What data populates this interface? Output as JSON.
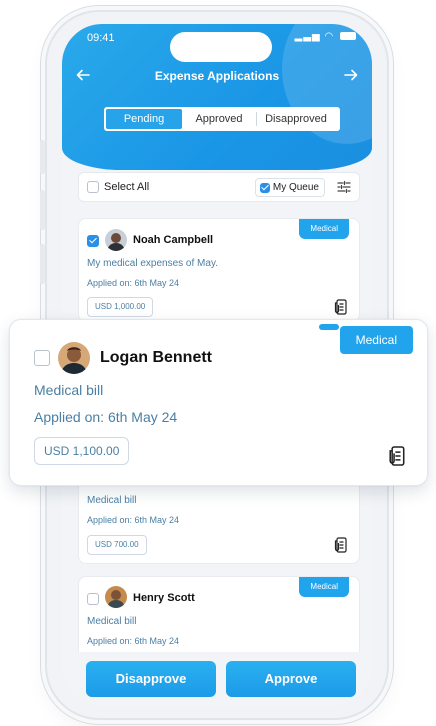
{
  "status_bar": {
    "time": "09:41"
  },
  "header": {
    "title": "Expense Applications"
  },
  "tabs": [
    {
      "label": "Pending",
      "active": true
    },
    {
      "label": "Approved",
      "active": false
    },
    {
      "label": "Disapproved",
      "active": false
    }
  ],
  "filter": {
    "select_all": "Select All",
    "my_queue": "My Queue",
    "my_queue_checked": true
  },
  "cards": [
    {
      "name": "Noah Campbell",
      "description": "My medical expenses of May.",
      "applied": "Applied on: 6th May 24",
      "amount": "USD 1,000.00",
      "badge": "Medical",
      "checked": true
    },
    {
      "name": "Logan Bennett",
      "description": "Medical bill",
      "applied": "Applied on: 6th May 24",
      "amount": "USD 1,100.00",
      "badge": "Medical",
      "checked": false
    },
    {
      "name": "",
      "description": "Medical bill",
      "applied": "Applied on: 6th May 24",
      "amount": "USD 700.00",
      "badge": "",
      "checked": false
    },
    {
      "name": "Henry Scott",
      "description": "Medical bill",
      "applied": "Applied on: 6th May 24",
      "amount": "",
      "badge": "Medical",
      "checked": false
    }
  ],
  "actions": {
    "disapprove": "Disapprove",
    "approve": "Approve"
  },
  "colors": {
    "primary": "#1f9fea",
    "text_muted": "#4a7fa4"
  }
}
